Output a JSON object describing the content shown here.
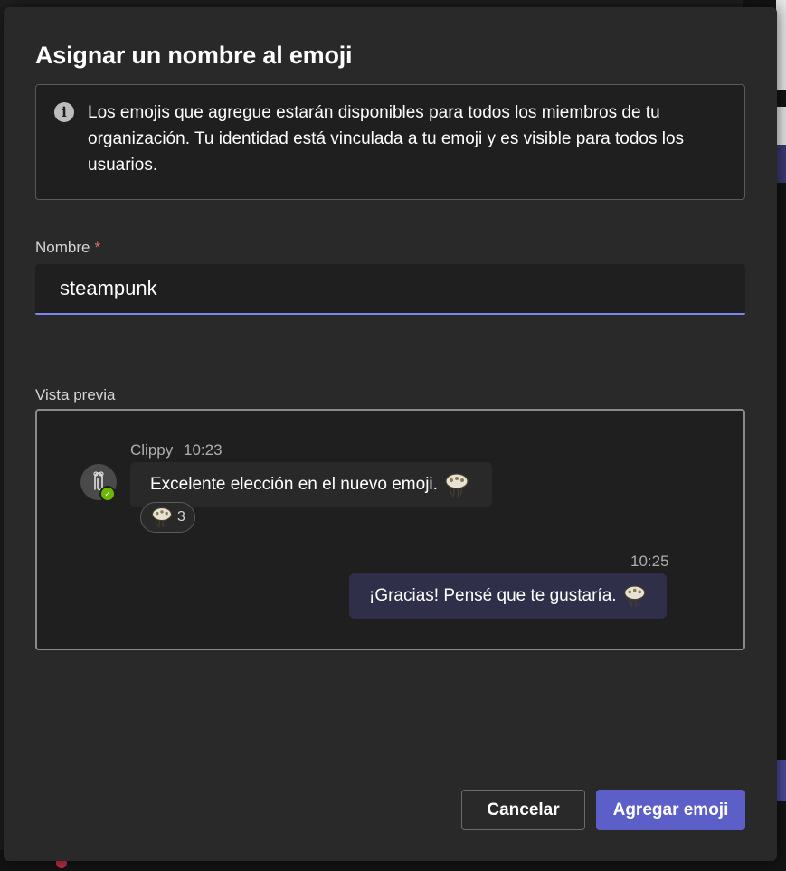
{
  "dialog": {
    "title": "Asignar un nombre al emoji",
    "info_icon": "info-icon",
    "info_text": "Los emojis que agregue estarán disponibles para todos los miembros de tu organización. Tu identidad está vinculada a tu emoji y es visible para todos los usuarios."
  },
  "name_field": {
    "label": "Nombre",
    "required_mark": "*",
    "value": "steampunk"
  },
  "preview": {
    "label": "Vista previa",
    "incoming": {
      "sender": "Clippy",
      "time": "10:23",
      "text": "Excelente elección en el nuevo emoji.",
      "reaction_count": "3",
      "avatar_icon": "paperclip-icon",
      "presence": "available"
    },
    "outgoing": {
      "time": "10:25",
      "text": "¡Gracias! Pensé que te gustaría."
    },
    "emoji_icon": "steampunk-jellyfish-emoji"
  },
  "buttons": {
    "cancel_label": "Cancelar",
    "add_label": "Agregar emoji"
  },
  "colors": {
    "accent": "#5b5fc7",
    "focus_underline": "#7f85f5",
    "dialog_bg": "#292929",
    "presence_available": "#6bb700",
    "required": "#e06a74"
  }
}
